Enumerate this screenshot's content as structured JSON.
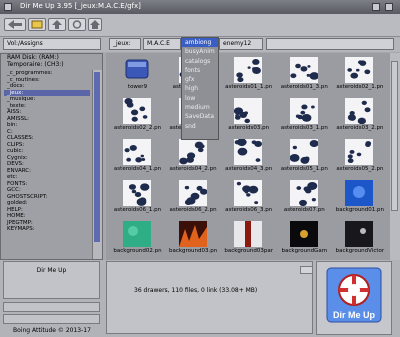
{
  "window": {
    "title": "Dir Me Up 3.95 [_jeux:M.A.C.E/gfx]"
  },
  "path": {
    "volume": "Vol:/Assigns",
    "crumbs": [
      "_jeux:",
      "M.A.C.E",
      "gfx",
      "enemy12"
    ]
  },
  "left_panel": {
    "ram_disk": "RAM Disk: (RAM:)",
    "temp": "Temporaire: (CH3:)",
    "items": [
      "_c_programmes:",
      "_c_routines:",
      "_docs:",
      "_jeux:",
      "_musique:",
      "_texte:",
      "AISS:",
      "AMISSL:",
      "bin:",
      "C:",
      "CLASSES:",
      "CLIPS:",
      "cubic:",
      "Cygnix:",
      "DEVS:",
      "ENVARC:",
      "etc:",
      "FONTS:",
      "GCC:",
      "GHOSTSCRIPT:",
      "golded:",
      "HELP:",
      "HOME:",
      "JPEGTMP:",
      "KEYMAPS:"
    ],
    "selected_index": 3
  },
  "dropdown": {
    "options": [
      "ambiong",
      "busyAnim",
      "catalogs",
      "fonts",
      "gfx",
      "high",
      "low",
      "medium",
      "SaveData",
      "snd"
    ],
    "highlighted_index": 0
  },
  "files": [
    {
      "name": "tower9",
      "icon": "drive"
    },
    {
      "name": "asteroids01.pn",
      "icon": "asteroid"
    },
    {
      "name": "asteroids01_1.pn",
      "icon": "asteroid"
    },
    {
      "name": "asteroids01_3.pn",
      "icon": "asteroid"
    },
    {
      "name": "asteroids02_1.pn",
      "icon": "asteroid"
    },
    {
      "name": "asteroids02_2.pn",
      "icon": "asteroid"
    },
    {
      "name": "asteroids02_3.pn",
      "icon": "asteroid"
    },
    {
      "name": "asteroids03.pn",
      "icon": "asteroid"
    },
    {
      "name": "asteroids03_1.pn",
      "icon": "asteroid"
    },
    {
      "name": "asteroids03_2.pn",
      "icon": "asteroid"
    },
    {
      "name": "asteroids04_1.pn",
      "icon": "asteroid"
    },
    {
      "name": "asteroids04_2.pn",
      "icon": "asteroid"
    },
    {
      "name": "asteroids04_3.pn",
      "icon": "asteroid"
    },
    {
      "name": "asteroids05_1.pn",
      "icon": "asteroid"
    },
    {
      "name": "asteroids05_2.pn",
      "icon": "asteroid"
    },
    {
      "name": "asteroids06_1.pn",
      "icon": "asteroid"
    },
    {
      "name": "asteroids06_2.pn",
      "icon": "asteroid"
    },
    {
      "name": "asteroids06_3.pn",
      "icon": "asteroid"
    },
    {
      "name": "asteroids07.pn",
      "icon": "asteroid"
    },
    {
      "name": "background01.pn",
      "icon": "bg-blue"
    },
    {
      "name": "background02.pn",
      "icon": "bg-green"
    },
    {
      "name": "background03.pn",
      "icon": "bg-fire"
    },
    {
      "name": "background03par",
      "icon": "bg-stripes"
    },
    {
      "name": "backgroundGam",
      "icon": "bg-dark"
    },
    {
      "name": "backgroundVictor",
      "icon": "bg-dark2"
    }
  ],
  "status": {
    "app_name": "Dir Me Up",
    "summary": "36 drawers, 110 files, 0 link (33.08+ MB)",
    "credit": "Boing Attitude © 2013-17",
    "logo_text": "Dir Me Up"
  },
  "colors": {
    "selection": "#5a66a8",
    "dropdown_highlight": "#3a5ec4",
    "scroll_thumb": "#5f6bb0"
  }
}
